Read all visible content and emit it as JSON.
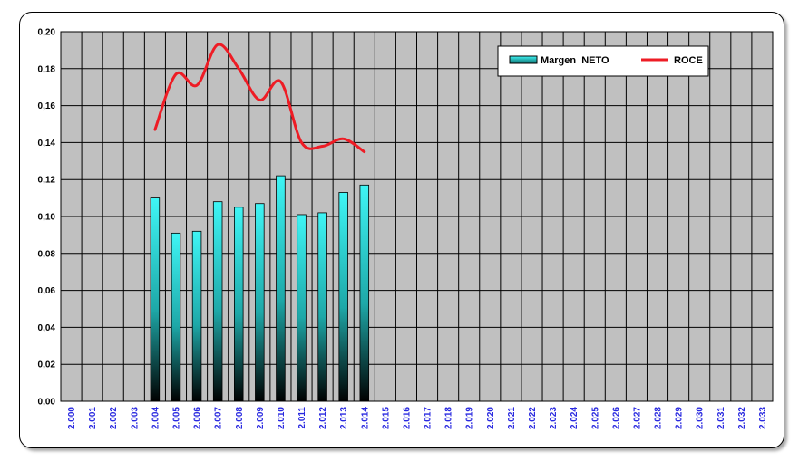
{
  "chart_data": {
    "type": "bar+line",
    "x": [
      "2.000",
      "2.001",
      "2.002",
      "2.003",
      "2.004",
      "2.005",
      "2.006",
      "2.007",
      "2.008",
      "2.009",
      "2.010",
      "2.011",
      "2.012",
      "2.013",
      "2.014",
      "2.015",
      "2.016",
      "2.017",
      "2.018",
      "2.019",
      "2.020",
      "2.021",
      "2.022",
      "2.023",
      "2.024",
      "2.025",
      "2.026",
      "2.027",
      "2.028",
      "2.029",
      "2.030",
      "2.031",
      "2.032",
      "2.033"
    ],
    "series": [
      {
        "name": "Margen  NETO",
        "type": "bar",
        "color": "#33f0f0",
        "values": [
          null,
          null,
          null,
          null,
          0.11,
          0.091,
          0.092,
          0.108,
          0.105,
          0.107,
          0.122,
          0.101,
          0.102,
          0.113,
          0.117,
          null,
          null,
          null,
          null,
          null,
          null,
          null,
          null,
          null,
          null,
          null,
          null,
          null,
          null,
          null,
          null,
          null,
          null,
          null
        ]
      },
      {
        "name": "ROCE",
        "type": "line",
        "color": "#ee1c25",
        "values": [
          null,
          null,
          null,
          null,
          0.147,
          0.177,
          0.171,
          0.193,
          0.18,
          0.163,
          0.173,
          0.14,
          0.138,
          0.142,
          0.135,
          null,
          null,
          null,
          null,
          null,
          null,
          null,
          null,
          null,
          null,
          null,
          null,
          null,
          null,
          null,
          null,
          null,
          null,
          null
        ]
      }
    ],
    "ylim": [
      0,
      0.2
    ],
    "yticks": [
      "0,00",
      "0,02",
      "0,04",
      "0,06",
      "0,08",
      "0,10",
      "0,12",
      "0,14",
      "0,16",
      "0,18",
      "0,20"
    ],
    "grid": true,
    "plot_background": "#c0c0c0",
    "legend_position": "top-right"
  }
}
